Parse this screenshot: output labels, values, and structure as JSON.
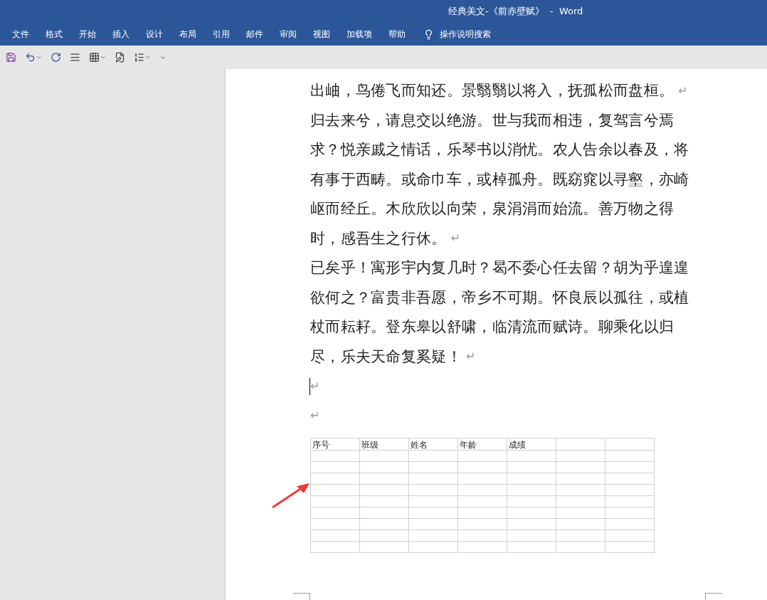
{
  "window": {
    "title": "经典美文-《前赤壁赋》  -  Word"
  },
  "menu": {
    "items": [
      "文件",
      "格式",
      "开始",
      "插入",
      "设计",
      "布局",
      "引用",
      "邮件",
      "审阅",
      "视图",
      "加载项",
      "帮助"
    ],
    "search": "操作说明搜索"
  },
  "document": {
    "paragraphs": [
      {
        "lines": [
          "出岫，鸟倦飞而知还。景翳翳以将入，抚孤松而盘桓。"
        ],
        "mark": "↵",
        "caret": false
      },
      {
        "lines": [
          "归去来兮，请息交以绝游。世与我而相违，复驾言兮焉",
          "求？悦亲戚之情话，乐琴书以消忧。农人告余以春及，将",
          "有事于西畴。或命巾车，或棹孤舟。既窈窕以寻壑，亦崎",
          "岖而经丘。木欣欣以向荣，泉涓涓而始流。善万物之得",
          "时，感吾生之行休。"
        ],
        "mark": "↵",
        "caret": false
      },
      {
        "lines": [
          "已矣乎！寓形宇内复几时？曷不委心任去留？胡为乎遑遑",
          "欲何之？富贵非吾愿，帝乡不可期。怀良辰以孤往，或植",
          "杖而耘耔。登东皋以舒啸，临清流而赋诗。聊乘化以归",
          "尽，乐夫天命复奚疑！"
        ],
        "mark": "↵",
        "caret": false
      },
      {
        "mark": "↵",
        "caret": true
      },
      {
        "mark": "↵",
        "caret": false
      }
    ],
    "table": {
      "columns": [
        "序号",
        "班级",
        "姓名",
        "年龄",
        "成绩"
      ]
    }
  }
}
